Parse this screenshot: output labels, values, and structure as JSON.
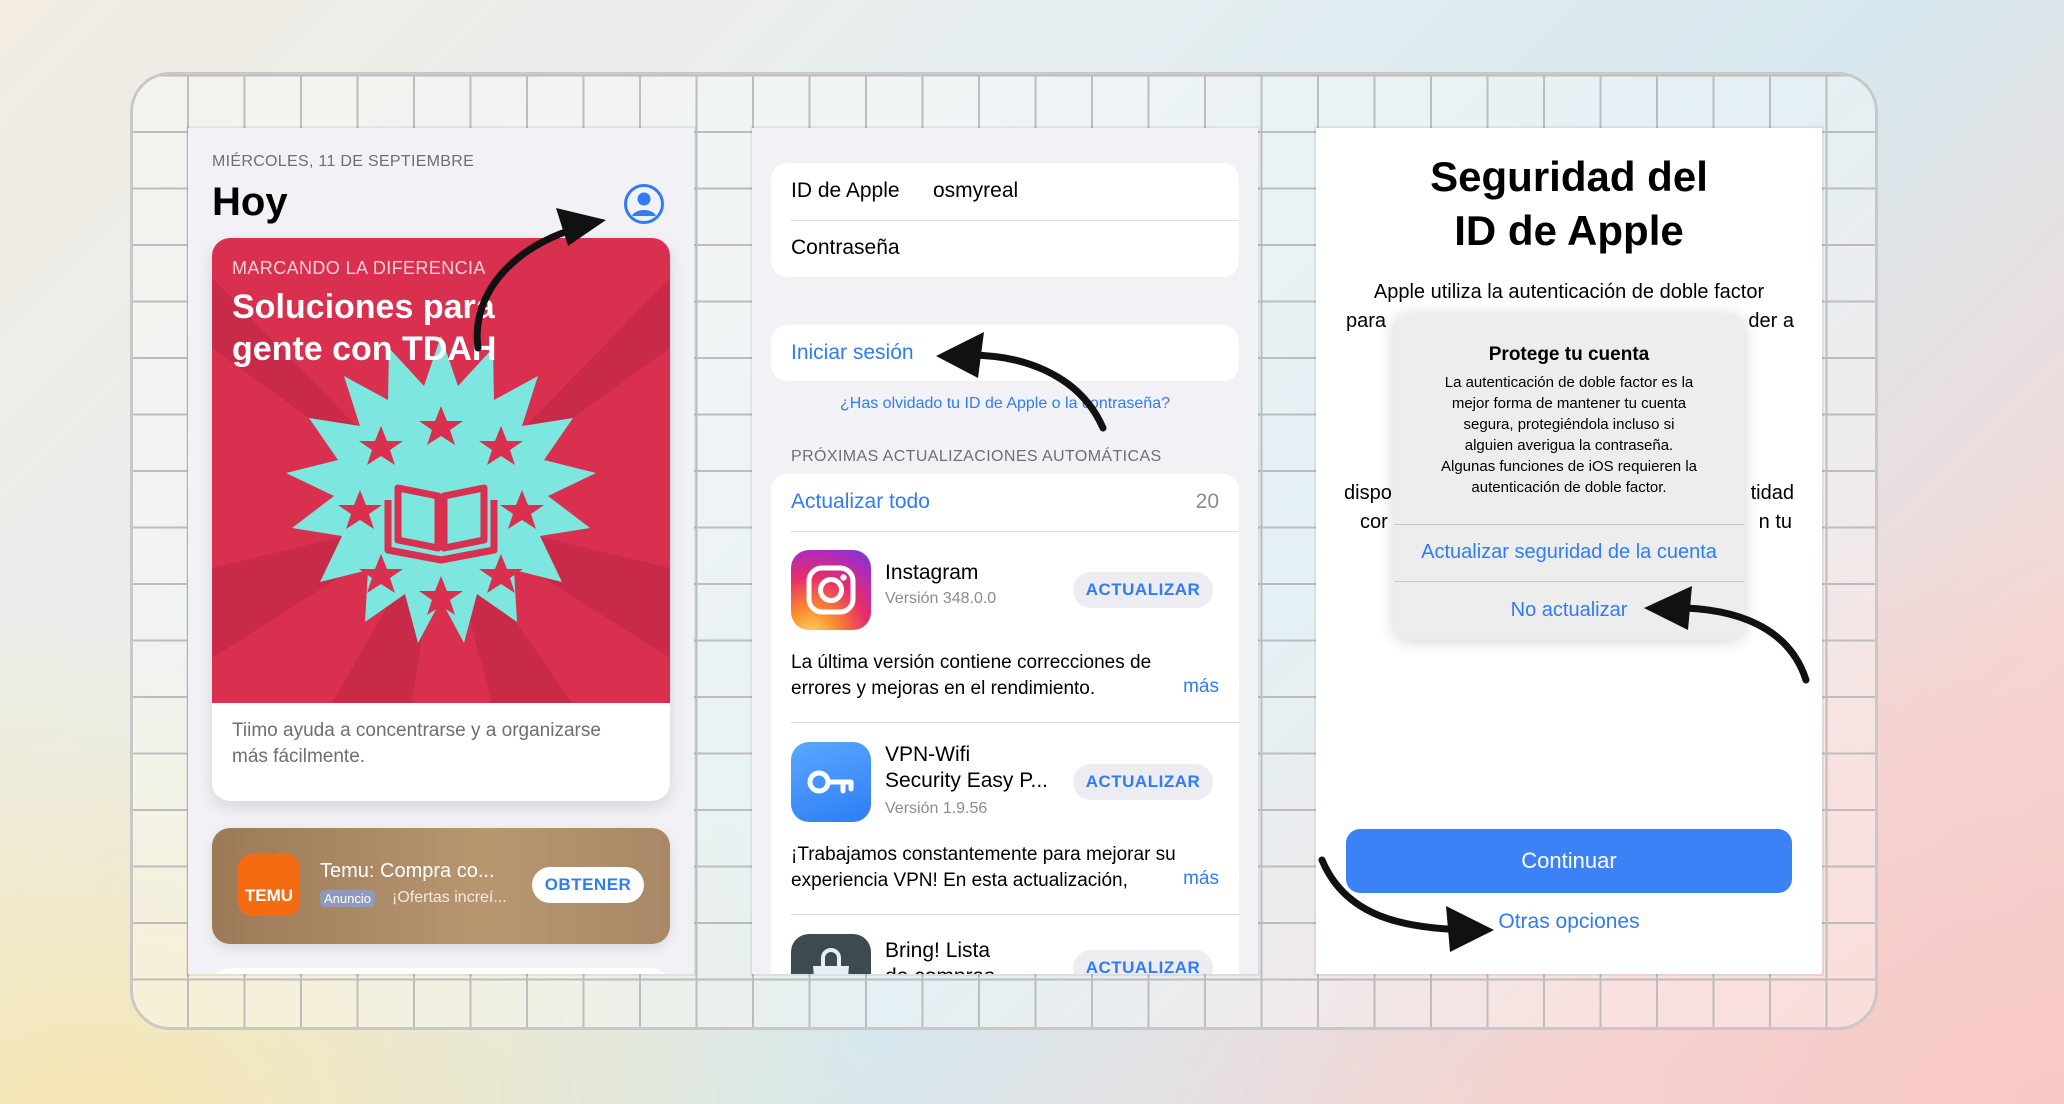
{
  "colors": {
    "accent": "#2f7cf6",
    "card_red": "#d9304f",
    "star_cyan": "#7ce6df",
    "continue_btn": "#3a82f6"
  },
  "today": {
    "date": "MIÉRCOLES, 11 DE SEPTIEMBRE",
    "title": "Hoy",
    "avatar_icon": "person-circle-icon",
    "feature": {
      "eyebrow": "MARCANDO LA DIFERENCIA",
      "headline_1": "Soluciones para",
      "headline_2": "gente con TDAH",
      "caption": "Tiimo ayuda a concentrarse y a organizarse más fácilmente."
    },
    "ad": {
      "app_name": "Temu: Compra co...",
      "badge": "Anuncio",
      "subtitle": "¡Ofertas increí...",
      "icon_text": "TEMU",
      "get_button": "OBTENER"
    }
  },
  "account": {
    "apple_id_label": "ID de Apple",
    "apple_id_value": "osmyreal",
    "password_label": "Contraseña",
    "sign_in": "Iniciar sesión",
    "forgot": "¿Has olvidado tu ID de Apple o la contraseña?",
    "section_header": "PRÓXIMAS ACTUALIZACIONES AUTOMÁTICAS",
    "update_all": "Actualizar todo",
    "update_count": "20",
    "apps": [
      {
        "name": "Instagram",
        "version": "Versión 348.0.0",
        "button": "ACTUALIZAR",
        "notes_1": "La última versión contiene correcciones de",
        "notes_2": "errores y mejoras en el rendimiento.",
        "more": "más"
      },
      {
        "name_1": "VPN-Wifi",
        "name_2": "Security Easy P...",
        "version": "Versión 1.9.56",
        "button": "ACTUALIZAR",
        "notes_1": "¡Trabajamos constantemente para mejorar su",
        "notes_2": "experiencia VPN! En esta actualización,",
        "more": "más"
      },
      {
        "name_1": "Bring! Lista",
        "name_2": "de compras",
        "button": "ACTUALIZAR"
      }
    ]
  },
  "security": {
    "title_1": "Seguridad del",
    "title_2": "ID de Apple",
    "body_1": "Apple utiliza la autenticación de doble factor",
    "body_2_left": "para",
    "body_2_right": "der a",
    "body_3_left": "dispo",
    "body_3_right": "tidad",
    "body_4_left": "cor",
    "body_4_right": "n tu",
    "alert": {
      "title": "Protege tu cuenta",
      "message_lines": [
        "La autenticación de doble factor es la",
        "mejor forma de mantener tu cuenta",
        "segura, protegiéndola incluso si",
        "alguien averigua la contraseña.",
        "Algunas funciones de iOS requieren la",
        "autenticación de doble factor."
      ],
      "primary_action": "Actualizar seguridad de la cuenta",
      "secondary_action": "No actualizar"
    },
    "continue_button": "Continuar",
    "other_options": "Otras opciones"
  }
}
